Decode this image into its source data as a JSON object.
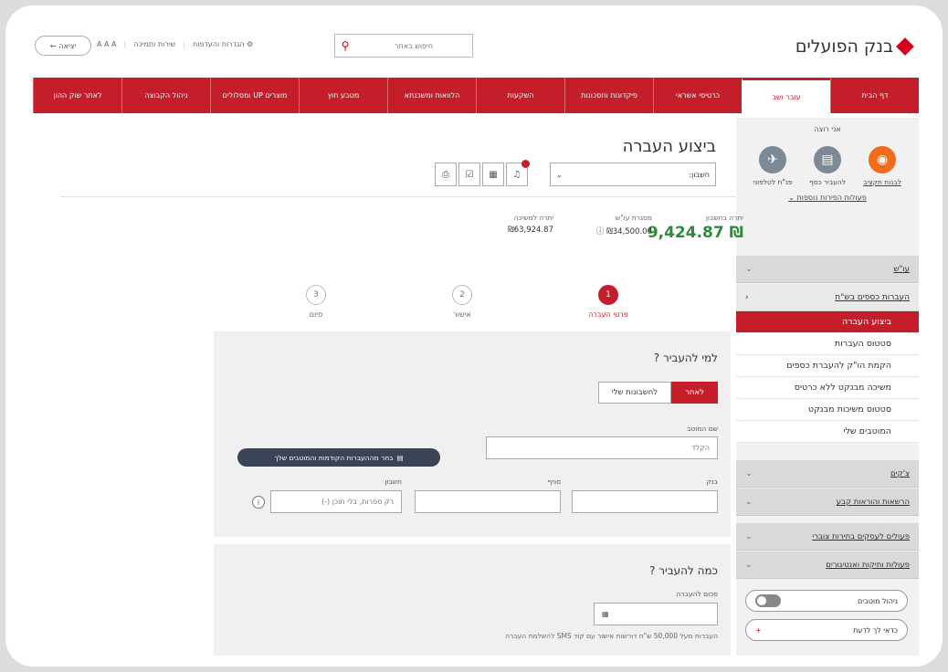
{
  "brand": {
    "name": "בנק הפועלים",
    "color": "#c41e2b"
  },
  "topbar": {
    "search_placeholder": "חיפוש באתר",
    "links": [
      "הגדרות והעדפות",
      "שירות ותמיכה",
      "A A A"
    ],
    "exit_label": "יציאה"
  },
  "nav": {
    "items": [
      "דף הבית",
      "עובר ושב",
      "כרטיסי אשראי",
      "פיקדונות וחסכונות",
      "השקעות",
      "הלוואות ומשכנתא",
      "מטבע חוץ",
      "מוצרים UP ומסלולים",
      "ניהול הקבוצה",
      "לאתר שוק ההון"
    ],
    "active_index": 1
  },
  "sidebar": {
    "quick_title": "אני רוצה",
    "quick_actions": [
      {
        "label": "לבנות תקציב",
        "icon": "wallet-icon"
      },
      {
        "label": "להעביר כסף",
        "icon": "transfer-icon"
      },
      {
        "label": "פנ\"ח לטלפוני",
        "icon": "plane-icon"
      }
    ],
    "quick_more": "פעולות הפירות נוספות",
    "sections": {
      "main": "עו\"ש",
      "transfers": "העברות כספים בש\"ח",
      "checks": "צ'קים",
      "orders": "הרשאות והוראות קבע",
      "stockbroker": "פעולים לעסקים בחירות צוברי",
      "ops": "פעולות ותיקות ואנטיגורים"
    },
    "transfer_items": [
      "ביצוע העברה",
      "סטטוס העברות",
      "הקמת הו\"ק להעברת כספים",
      "משיכה מבנקט ללא כרטיס",
      "סטטוס משיכות מבנקט",
      "המוטבים שלי"
    ],
    "active_item_index": 0,
    "pill_toggle_label": "ניהול מוטבים",
    "pill_help_label": "כדאי לך לדעת"
  },
  "main": {
    "title": "ביצוע העברה",
    "account_label": "חשבון:",
    "balances": {
      "balance_label": "יתרה בחשבון",
      "balance_value": "₪ 9,424.87",
      "credit_label": "מסגרת עו\"ש",
      "credit_value": "₪34,500.00",
      "available_label": "יתרה למשיכה",
      "available_value": "₪63,924.87"
    },
    "steps": [
      {
        "num": "1",
        "label": "פרטי העברה"
      },
      {
        "num": "2",
        "label": "אישור"
      },
      {
        "num": "3",
        "label": "סיום"
      }
    ],
    "to_whom": {
      "title": "למי להעביר ?",
      "seg_other": "לאחר",
      "seg_mine": "לחשבונות שלי",
      "payee_label": "שם המוטב",
      "payee_placeholder": "הקלד",
      "history_button": "בחר מההעברות הקודמות והמוטבים שלך",
      "bank_label": "בנק",
      "branch_label": "סניף",
      "account_label": "חשבון",
      "account_placeholder": "רק ספרות, בלי תוכן (-)"
    },
    "how_much": {
      "title": "כמה להעביר ?",
      "amount_label": "סכום להעברה",
      "note": "העברות מעל 50,000 ש\"ח דורשות אישור עם קוד SMS להשלמת העברה"
    }
  }
}
